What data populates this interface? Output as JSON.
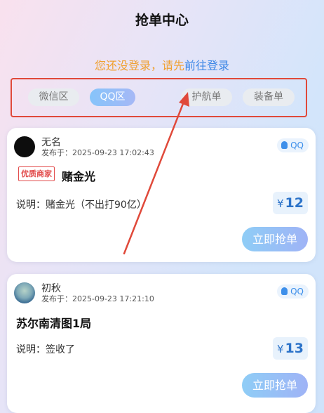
{
  "header": {
    "title": "抢单中心"
  },
  "login_tip": {
    "prefix": "您还没登录，请先",
    "link": "前往登录"
  },
  "tabs": [
    {
      "label": "微信区",
      "active": false
    },
    {
      "label": "QQ区",
      "active": true
    },
    {
      "label": "护航单",
      "active": false
    },
    {
      "label": "装备单",
      "active": false
    }
  ],
  "orders": [
    {
      "username": "无名",
      "publish_time": "发布于：2025-09-23 17:02:43",
      "platform": "QQ",
      "merchant_tag": "优质商家",
      "title": "赌金光",
      "description": "说明：赌金光（不出打90亿）",
      "currency": "¥",
      "price": "12",
      "button": "立即抢单",
      "avatar": "dark-avatar"
    },
    {
      "username": "初秋",
      "publish_time": "发布于：2025-09-23 17:21:10",
      "platform": "QQ",
      "title": "苏尔南清图1局",
      "description": "说明：签收了",
      "currency": "¥",
      "price": "13",
      "button": "立即抢单",
      "avatar": "photo-avatar"
    }
  ],
  "colors": {
    "accent": "#3b86e6",
    "warning_text": "#f0a030",
    "annotation_red": "#e0493a",
    "merchant_red": "#e24c4c",
    "price_blue": "#2c73c9"
  }
}
